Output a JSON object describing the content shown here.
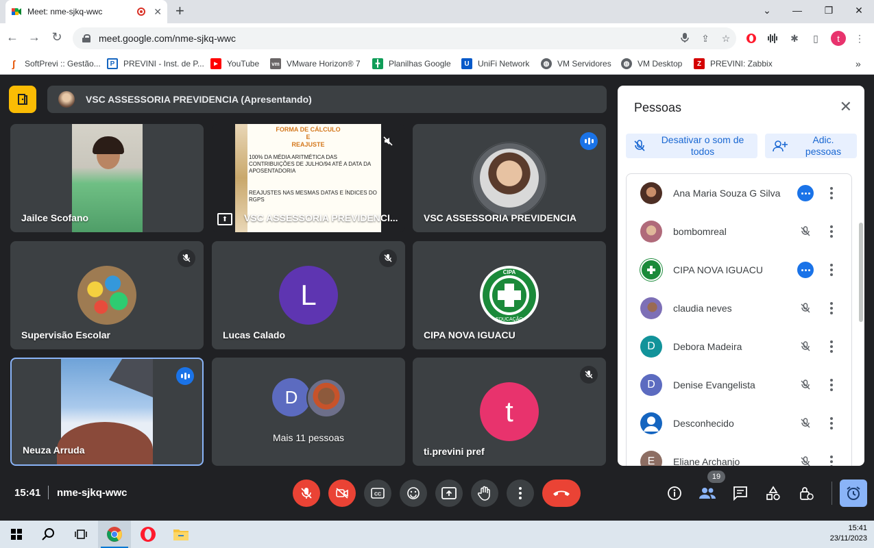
{
  "browser": {
    "tab_title": "Meet: nme-sjkq-wwc",
    "url": "meet.google.com/nme-sjkq-wwc",
    "profile_initial": "t",
    "bookmarks": [
      {
        "label": "SoftPrevi :: Gestão..."
      },
      {
        "label": "PREVINI - Inst. de P..."
      },
      {
        "label": "YouTube"
      },
      {
        "label": "VMware Horizon® 7"
      },
      {
        "label": "Planilhas Google"
      },
      {
        "label": "UniFi Network"
      },
      {
        "label": "VM Servidores"
      },
      {
        "label": "VM Desktop"
      },
      {
        "label": "PREVINI: Zabbix"
      }
    ]
  },
  "meet": {
    "presenting_banner": "VSC ASSESSORIA PREVIDENCIA (Apresentando)",
    "tiles": [
      {
        "name": "Jailce Scofano"
      },
      {
        "name": "VSC ASSESSORIA PREVIDENCI..."
      },
      {
        "name": "VSC ASSESSORIA PREVIDENCIA"
      },
      {
        "name": "Supervisão Escolar"
      },
      {
        "name": "Lucas Calado",
        "initial": "L"
      },
      {
        "name": "CIPA NOVA IGUACU"
      },
      {
        "name": "Neuza Arruda"
      },
      {
        "name": "Mais 11 pessoas",
        "initial": "D"
      },
      {
        "name": "ti.previni pref",
        "initial": "t"
      }
    ],
    "slide": {
      "title": "FORMA DE CÁLCULO\nE\nREAJUSTE",
      "bullet1": "100% da média aritmética das contribuições de julho/94 até a data da aposentadoria",
      "bullet2": "Reajustes nas mesmas datas e índices do RGPS"
    },
    "cipa_logo": {
      "top": "CIPA",
      "bottom": "EDUCAÇÃO"
    },
    "clock": "15:41",
    "meeting_code": "nme-sjkq-wwc",
    "participants_count": "19"
  },
  "people_panel": {
    "title": "Pessoas",
    "mute_all_label": "Desativar o som de todos",
    "add_people_label": "Adic. pessoas",
    "people": [
      {
        "name": "Ana Maria Souza G Silva",
        "state": "speaking"
      },
      {
        "name": "bombomreal",
        "state": "muted"
      },
      {
        "name": "CIPA NOVA IGUACU",
        "state": "speaking"
      },
      {
        "name": "claudia neves",
        "state": "muted"
      },
      {
        "name": "Debora Madeira",
        "state": "muted",
        "initial": "D",
        "color": "#12939a"
      },
      {
        "name": "Denise Evangelista",
        "state": "muted",
        "initial": "D",
        "color": "#5c6bc0"
      },
      {
        "name": "Desconhecido",
        "state": "muted"
      },
      {
        "name": "Eliane Archanjo",
        "state": "muted",
        "initial": "E",
        "color": "#8d6e63"
      }
    ]
  },
  "taskbar": {
    "time": "15:41",
    "date": "23/11/2023"
  },
  "colors": {
    "meet_bg": "#202124",
    "tile_bg": "#3c4043",
    "accent_blue": "#1a73e8",
    "danger_red": "#ea4335",
    "lucas_avatar": "#5e35b1",
    "ti_avatar": "#e8336d",
    "mais_avatar": "#5c6bc0"
  }
}
